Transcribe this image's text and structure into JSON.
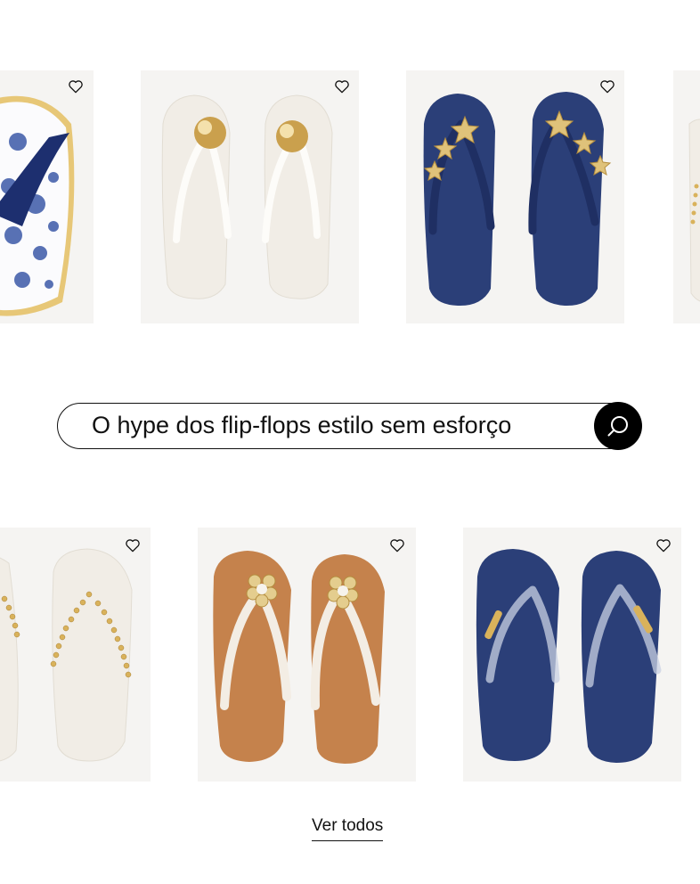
{
  "search": {
    "text": "O hype dos flip-flops estilo sem esforço"
  },
  "products_row1": [
    {
      "name": "blue-white-patterned-flip-flop",
      "icon": "heart-icon"
    },
    {
      "name": "cream-flip-flop-gold-sphere",
      "icon": "heart-icon"
    },
    {
      "name": "navy-flip-flop-gold-starfish",
      "icon": "heart-icon"
    },
    {
      "name": "partial-flip-flop",
      "icon": "heart-icon"
    }
  ],
  "products_row2": [
    {
      "name": "cream-flip-flop-gold-chain",
      "icon": "heart-icon"
    },
    {
      "name": "caramel-flip-flop-gold-flower",
      "icon": "heart-icon"
    },
    {
      "name": "navy-flip-flop-clear-strap",
      "icon": "heart-icon"
    }
  ],
  "footer": {
    "link_label": "Ver todos"
  },
  "colors": {
    "card_bg": "#f5f4f2",
    "navy": "#2b3f78",
    "cream": "#f1ede6",
    "caramel": "#c5824c",
    "gold": "#d9b25b"
  }
}
